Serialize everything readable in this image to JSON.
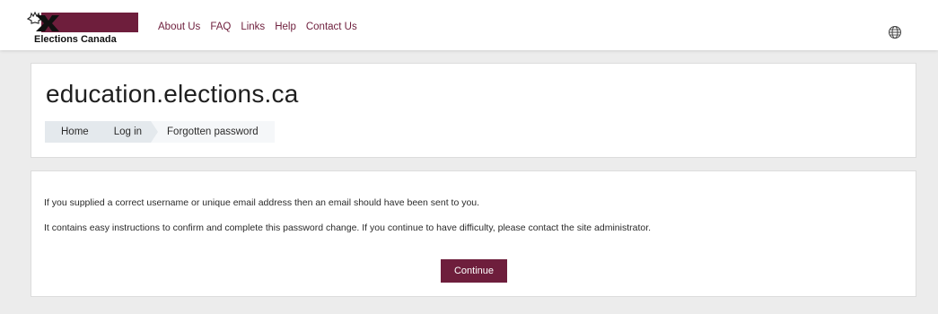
{
  "header": {
    "logo_text": "Elections Canada",
    "nav_links": [
      "About Us",
      "FAQ",
      "Links",
      "Help",
      "Contact Us"
    ],
    "language_icon": "globe-icon"
  },
  "page": {
    "title": "education.elections.ca",
    "breadcrumb": [
      "Home",
      "Log in",
      "Forgotten password"
    ]
  },
  "content": {
    "message_1": "If you supplied a correct username or unique email address then an email should have been sent to you.",
    "message_2": "It contains easy instructions to confirm and complete this password change. If you continue to have difficulty, please contact the site administrator.",
    "continue_label": "Continue"
  },
  "colors": {
    "brand": "#6e1e3c",
    "background": "#ececec",
    "breadcrumb_bg": "#eef2f5"
  }
}
